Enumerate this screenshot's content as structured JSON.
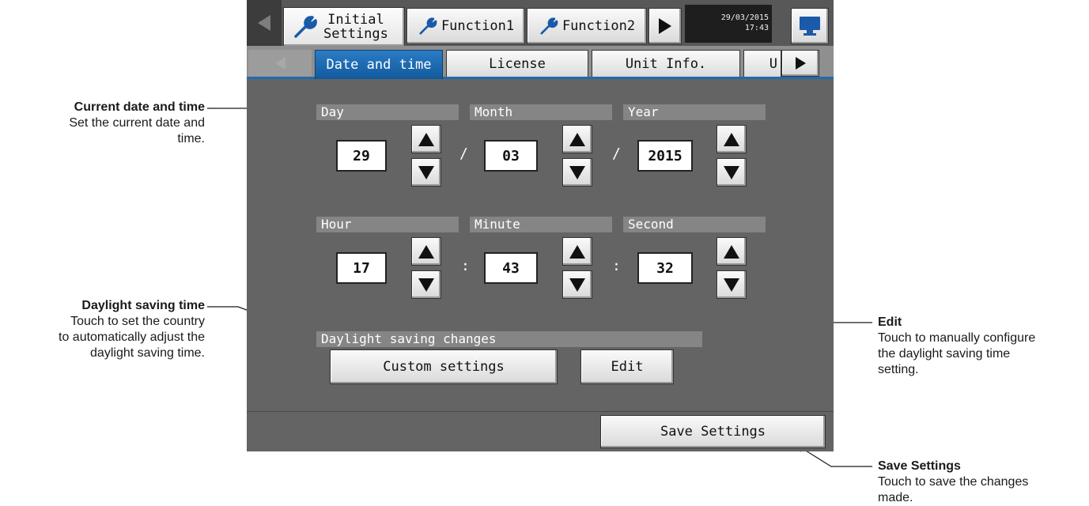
{
  "topbar": {
    "tabs": [
      {
        "label_line1": "Initial",
        "label_line2": "Settings"
      },
      {
        "label": "Function1"
      },
      {
        "label": "Function2"
      }
    ],
    "date": "29/03/2015",
    "time": "17:43",
    "icons": {
      "back": "left-arrow-icon",
      "next": "right-arrow-icon",
      "tool": "wrench-icon",
      "monitor": "monitor-icon"
    }
  },
  "subtabs": [
    {
      "label": "Date and time",
      "active": true
    },
    {
      "label": "License"
    },
    {
      "label": "Unit Info."
    },
    {
      "label": "U"
    }
  ],
  "datetime": {
    "day_label": "Day",
    "day": "29",
    "month_label": "Month",
    "month": "03",
    "year_label": "Year",
    "year": "2015",
    "hour_label": "Hour",
    "hour": "17",
    "minute_label": "Minute",
    "minute": "43",
    "second_label": "Second",
    "second": "32",
    "date_sep": "/",
    "time_sep": ":"
  },
  "dst": {
    "label": "Daylight saving changes",
    "custom_button": "Custom settings",
    "edit_button": "Edit"
  },
  "save_button": "Save Settings",
  "colors": {
    "accent_blue": "#1e6bb0",
    "screen_bg": "#646464"
  },
  "annotations": {
    "current": {
      "title": "Current date and time",
      "line1": "Set the current date and",
      "line2": "time."
    },
    "daylight": {
      "title": "Daylight saving time",
      "line1": "Touch to set the country",
      "line2": "to automatically adjust the",
      "line3": "daylight saving time."
    },
    "edit": {
      "title": "Edit",
      "line1": "Touch to manually configure",
      "line2": "the daylight saving time",
      "line3": "setting."
    },
    "save": {
      "title": "Save Settings",
      "line1": "Touch to save the changes",
      "line2": "made."
    }
  }
}
